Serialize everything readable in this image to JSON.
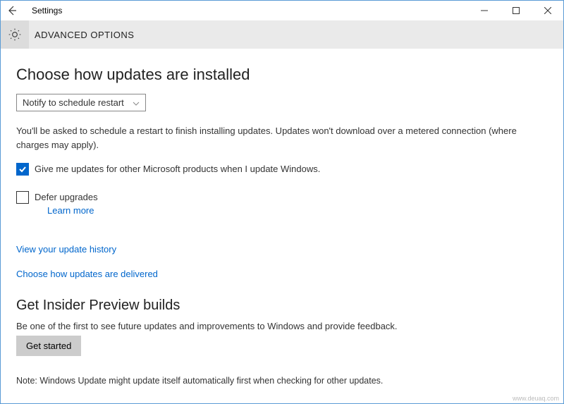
{
  "window": {
    "title": "Settings"
  },
  "header": {
    "page_name": "ADVANCED OPTIONS"
  },
  "section1": {
    "heading": "Choose how updates are installed",
    "dropdown_value": "Notify to schedule restart",
    "description": "You'll be asked to schedule a restart to finish installing updates. Updates won't download over a metered connection (where charges may apply).",
    "checkbox_products": {
      "checked": true,
      "label": "Give me updates for other Microsoft products when I update Windows."
    },
    "checkbox_defer": {
      "checked": false,
      "label": "Defer upgrades",
      "learn_more": "Learn more"
    },
    "link_history": "View your update history",
    "link_delivery": "Choose how updates are delivered"
  },
  "section2": {
    "heading": "Get Insider Preview builds",
    "description": "Be one of the first to see future updates and improvements to Windows and provide feedback.",
    "button": "Get started"
  },
  "note": "Note: Windows Update might update itself automatically first when checking for other updates.",
  "watermark": "www.deuaq.com"
}
